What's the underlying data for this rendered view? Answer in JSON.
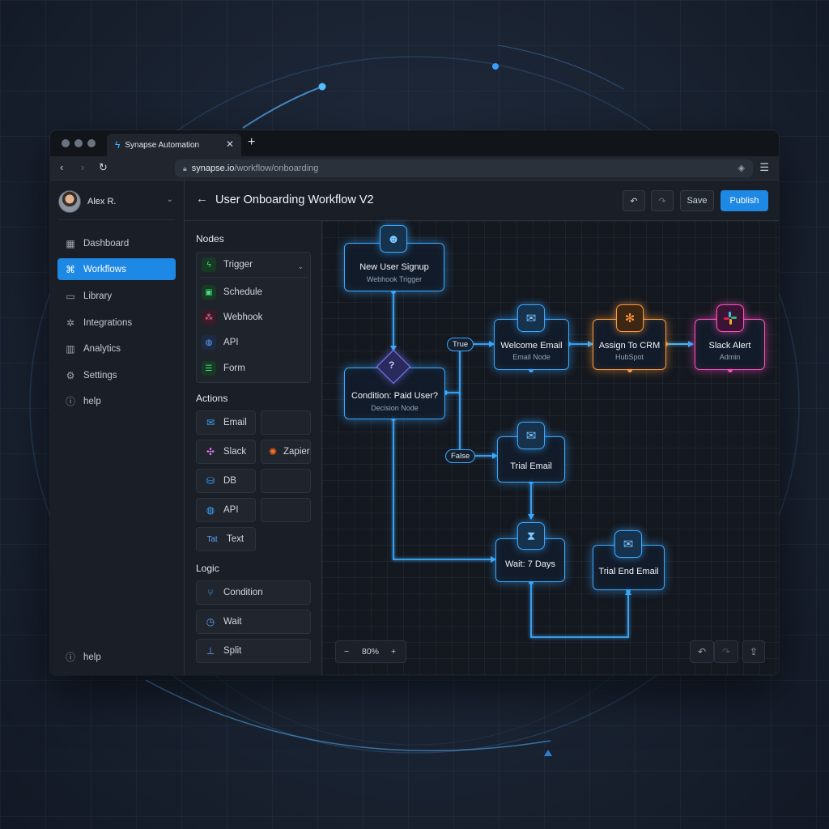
{
  "browser": {
    "tab_title": "Synapse Automation",
    "url_domain": "synapse.io",
    "url_path": "/workflow/onboarding"
  },
  "user": {
    "name": "Alex R."
  },
  "sidebar": {
    "items": [
      {
        "label": "Dashboard",
        "icon": "dashboard-icon",
        "active": false
      },
      {
        "label": "Workflows",
        "icon": "workflow-icon",
        "active": true
      },
      {
        "label": "Library",
        "icon": "folder-icon",
        "active": false
      },
      {
        "label": "Integrations",
        "icon": "plug-icon",
        "active": false
      },
      {
        "label": "Analytics",
        "icon": "bar-chart-icon",
        "active": false
      },
      {
        "label": "Settings",
        "icon": "gear-icon",
        "active": false
      },
      {
        "label": "help",
        "icon": "help-icon",
        "active": false
      }
    ],
    "footer_help": "help"
  },
  "header": {
    "title": "User Onboarding Workflow V2",
    "save_label": "Save",
    "publish_label": "Publish"
  },
  "palette": {
    "nodes_label": "Nodes",
    "trigger_label": "Trigger",
    "triggers": [
      "Schedule",
      "Webhook",
      "API",
      "Form"
    ],
    "actions_label": "Actions",
    "actions": [
      "Email",
      "Slack",
      "Zapier",
      "DB",
      "API",
      "Text"
    ],
    "text_icon": "Tat",
    "logic_label": "Logic",
    "logic": [
      "Condition",
      "Wait",
      "Split"
    ]
  },
  "canvas": {
    "nodes": {
      "signup": {
        "title": "New User Signup",
        "subtitle": "Webhook Trigger"
      },
      "condition": {
        "title": "Condition: Paid User?",
        "subtitle": "Decision Node"
      },
      "welcome": {
        "title": "Welcome Email",
        "subtitle": "Email Node"
      },
      "crm": {
        "title": "Assign To CRM",
        "subtitle": "HubSpot"
      },
      "slack": {
        "title": "Slack Alert",
        "subtitle": "Admin"
      },
      "trial": {
        "title": "Trial Email"
      },
      "wait": {
        "title": "Wait: 7 Days"
      },
      "trial_end": {
        "title": "Trial End Email"
      }
    },
    "edge_labels": {
      "true": "True",
      "false": "False"
    },
    "zoom": "80%"
  },
  "colors": {
    "accent": "#1e88e5",
    "node_glow": "#3aa8ff",
    "crm_glow": "#ff9a3d",
    "slack_glow": "#ff4fbf",
    "decision": "#7c7cff"
  }
}
